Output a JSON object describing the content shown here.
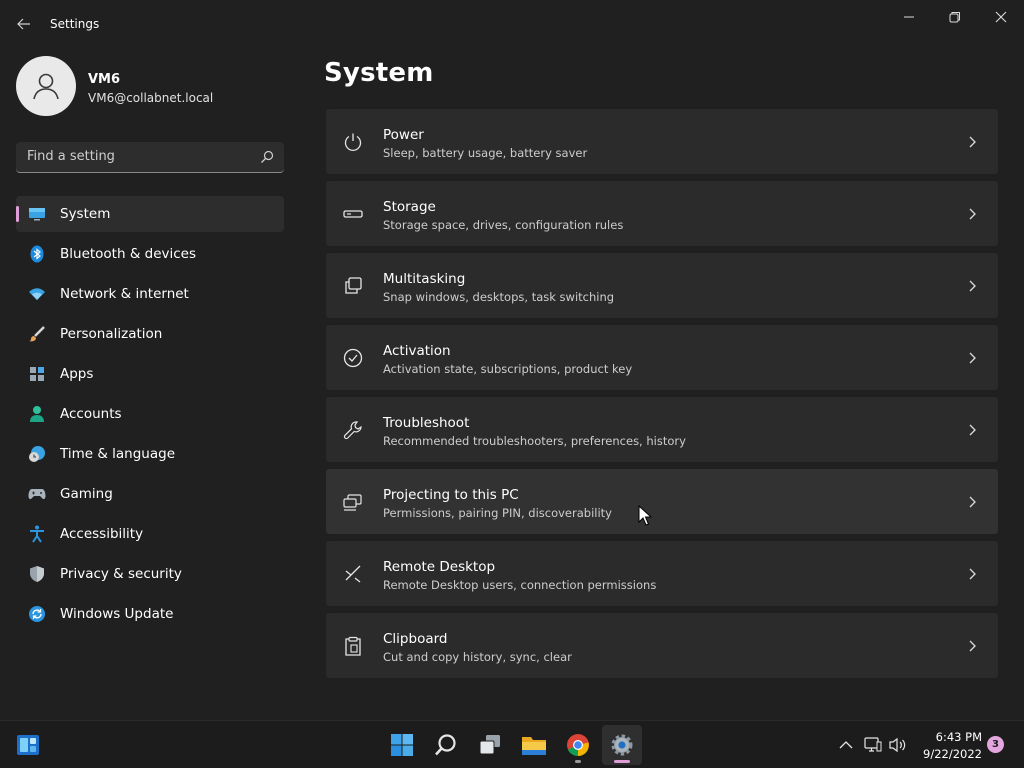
{
  "window": {
    "title": "Settings"
  },
  "profile": {
    "name": "VM6",
    "email": "VM6@collabnet.local"
  },
  "search": {
    "placeholder": "Find a setting"
  },
  "sidebar": {
    "items": [
      {
        "label": "System",
        "icon": "system-icon",
        "selected": true
      },
      {
        "label": "Bluetooth & devices",
        "icon": "bluetooth-icon"
      },
      {
        "label": "Network & internet",
        "icon": "wifi-icon"
      },
      {
        "label": "Personalization",
        "icon": "brush-icon"
      },
      {
        "label": "Apps",
        "icon": "apps-icon"
      },
      {
        "label": "Accounts",
        "icon": "accounts-icon"
      },
      {
        "label": "Time & language",
        "icon": "clock-globe-icon"
      },
      {
        "label": "Gaming",
        "icon": "gamepad-icon"
      },
      {
        "label": "Accessibility",
        "icon": "accessibility-icon"
      },
      {
        "label": "Privacy & security",
        "icon": "shield-icon"
      },
      {
        "label": "Windows Update",
        "icon": "update-icon"
      }
    ]
  },
  "main": {
    "title": "System",
    "cards": [
      {
        "title": "Power",
        "subtitle": "Sleep, battery usage, battery saver",
        "icon": "power-icon"
      },
      {
        "title": "Storage",
        "subtitle": "Storage space, drives, configuration rules",
        "icon": "storage-icon"
      },
      {
        "title": "Multitasking",
        "subtitle": "Snap windows, desktops, task switching",
        "icon": "multitasking-icon"
      },
      {
        "title": "Activation",
        "subtitle": "Activation state, subscriptions, product key",
        "icon": "activation-icon"
      },
      {
        "title": "Troubleshoot",
        "subtitle": "Recommended troubleshooters, preferences, history",
        "icon": "wrench-icon"
      },
      {
        "title": "Projecting to this PC",
        "subtitle": "Permissions, pairing PIN, discoverability",
        "icon": "projecting-icon"
      },
      {
        "title": "Remote Desktop",
        "subtitle": "Remote Desktop users, connection permissions",
        "icon": "remote-desktop-icon"
      },
      {
        "title": "Clipboard",
        "subtitle": "Cut and copy history, sync, clear",
        "icon": "clipboard-icon"
      }
    ]
  },
  "taskbar": {
    "apps": [
      "windows-start-icon",
      "search-icon",
      "task-view-icon",
      "file-explorer-icon",
      "chrome-icon",
      "settings-icon"
    ],
    "clock_time": "6:43 PM",
    "clock_date": "9/22/2022",
    "notification_count": "3"
  },
  "colors": {
    "background": "#202020",
    "card": "#2b2b2b",
    "accent": "#e09ed8",
    "taskbar": "#1c1c1c"
  }
}
